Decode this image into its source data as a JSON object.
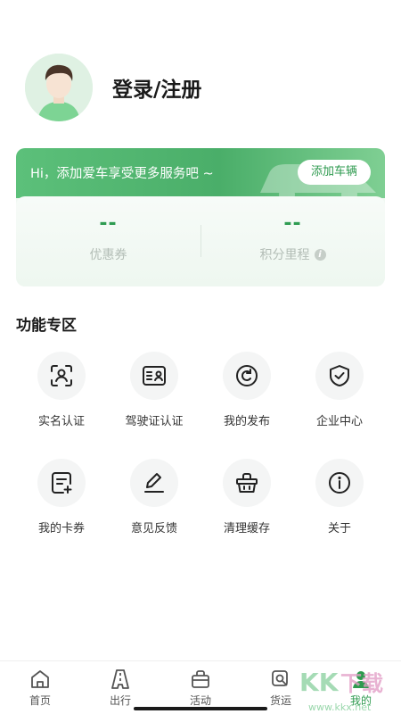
{
  "profile": {
    "login_label": "登录/注册",
    "avatar": "avatar-person"
  },
  "car_banner": {
    "message": "Hi，添加爱车享受更多服务吧 ~",
    "add_button": "添加车辆"
  },
  "stats": [
    {
      "value": "--",
      "label": "优惠券"
    },
    {
      "value": "--",
      "label": "积分里程",
      "info_icon": "i"
    }
  ],
  "features": {
    "title": "功能专区",
    "items": [
      {
        "label": "实名认证",
        "icon": "id-face-scan-icon"
      },
      {
        "label": "驾驶证认证",
        "icon": "driver-license-icon"
      },
      {
        "label": "我的发布",
        "icon": "refresh-circle-icon"
      },
      {
        "label": "企业中心",
        "icon": "shield-check-icon"
      },
      {
        "label": "我的卡券",
        "icon": "coupon-add-icon"
      },
      {
        "label": "意见反馈",
        "icon": "pen-edit-icon"
      },
      {
        "label": "清理缓存",
        "icon": "basket-icon"
      },
      {
        "label": "关于",
        "icon": "info-circle-icon"
      }
    ]
  },
  "bottom_nav": [
    {
      "label": "首页",
      "icon": "home-icon"
    },
    {
      "label": "出行",
      "icon": "road-icon"
    },
    {
      "label": "活动",
      "icon": "gift-bag-icon"
    },
    {
      "label": "货运",
      "icon": "truck-search-icon"
    },
    {
      "label": "我的",
      "icon": "user-icon",
      "active": true
    }
  ],
  "watermark": {
    "text": "KK下载",
    "url_text": "www.kkx.net"
  },
  "colors": {
    "brand_green": "#2e9a4f",
    "banner_green": "#5cc07a",
    "stat_label": "#b3bdb6"
  }
}
